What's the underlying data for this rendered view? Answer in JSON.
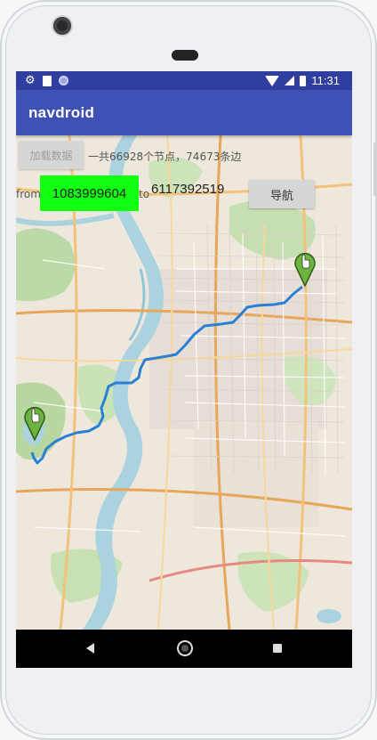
{
  "app": {
    "title": "navdroid"
  },
  "status_bar": {
    "time": "11:31"
  },
  "controls": {
    "load_button": "加载数据",
    "summary": "一共66928个节点，74673条边",
    "from_label": "from",
    "from_value": "1083999604",
    "to_label": "to",
    "to_value": "6117392519",
    "navigate_button": "导航"
  },
  "colors": {
    "app_bar": "#3f51b5",
    "status_bar": "#303f9f",
    "from_highlight": "#11ff11",
    "route": "#2a7fd4",
    "marker": "#6db33f"
  },
  "icons": {
    "status_left": [
      "gear-icon",
      "sd-card-icon",
      "sync-icon"
    ],
    "status_right": [
      "wifi-icon",
      "signal-icon",
      "battery-icon"
    ],
    "nav": [
      "back-icon",
      "home-icon",
      "recents-icon"
    ],
    "map_markers": [
      "start-marker-icon",
      "end-marker-icon"
    ]
  }
}
